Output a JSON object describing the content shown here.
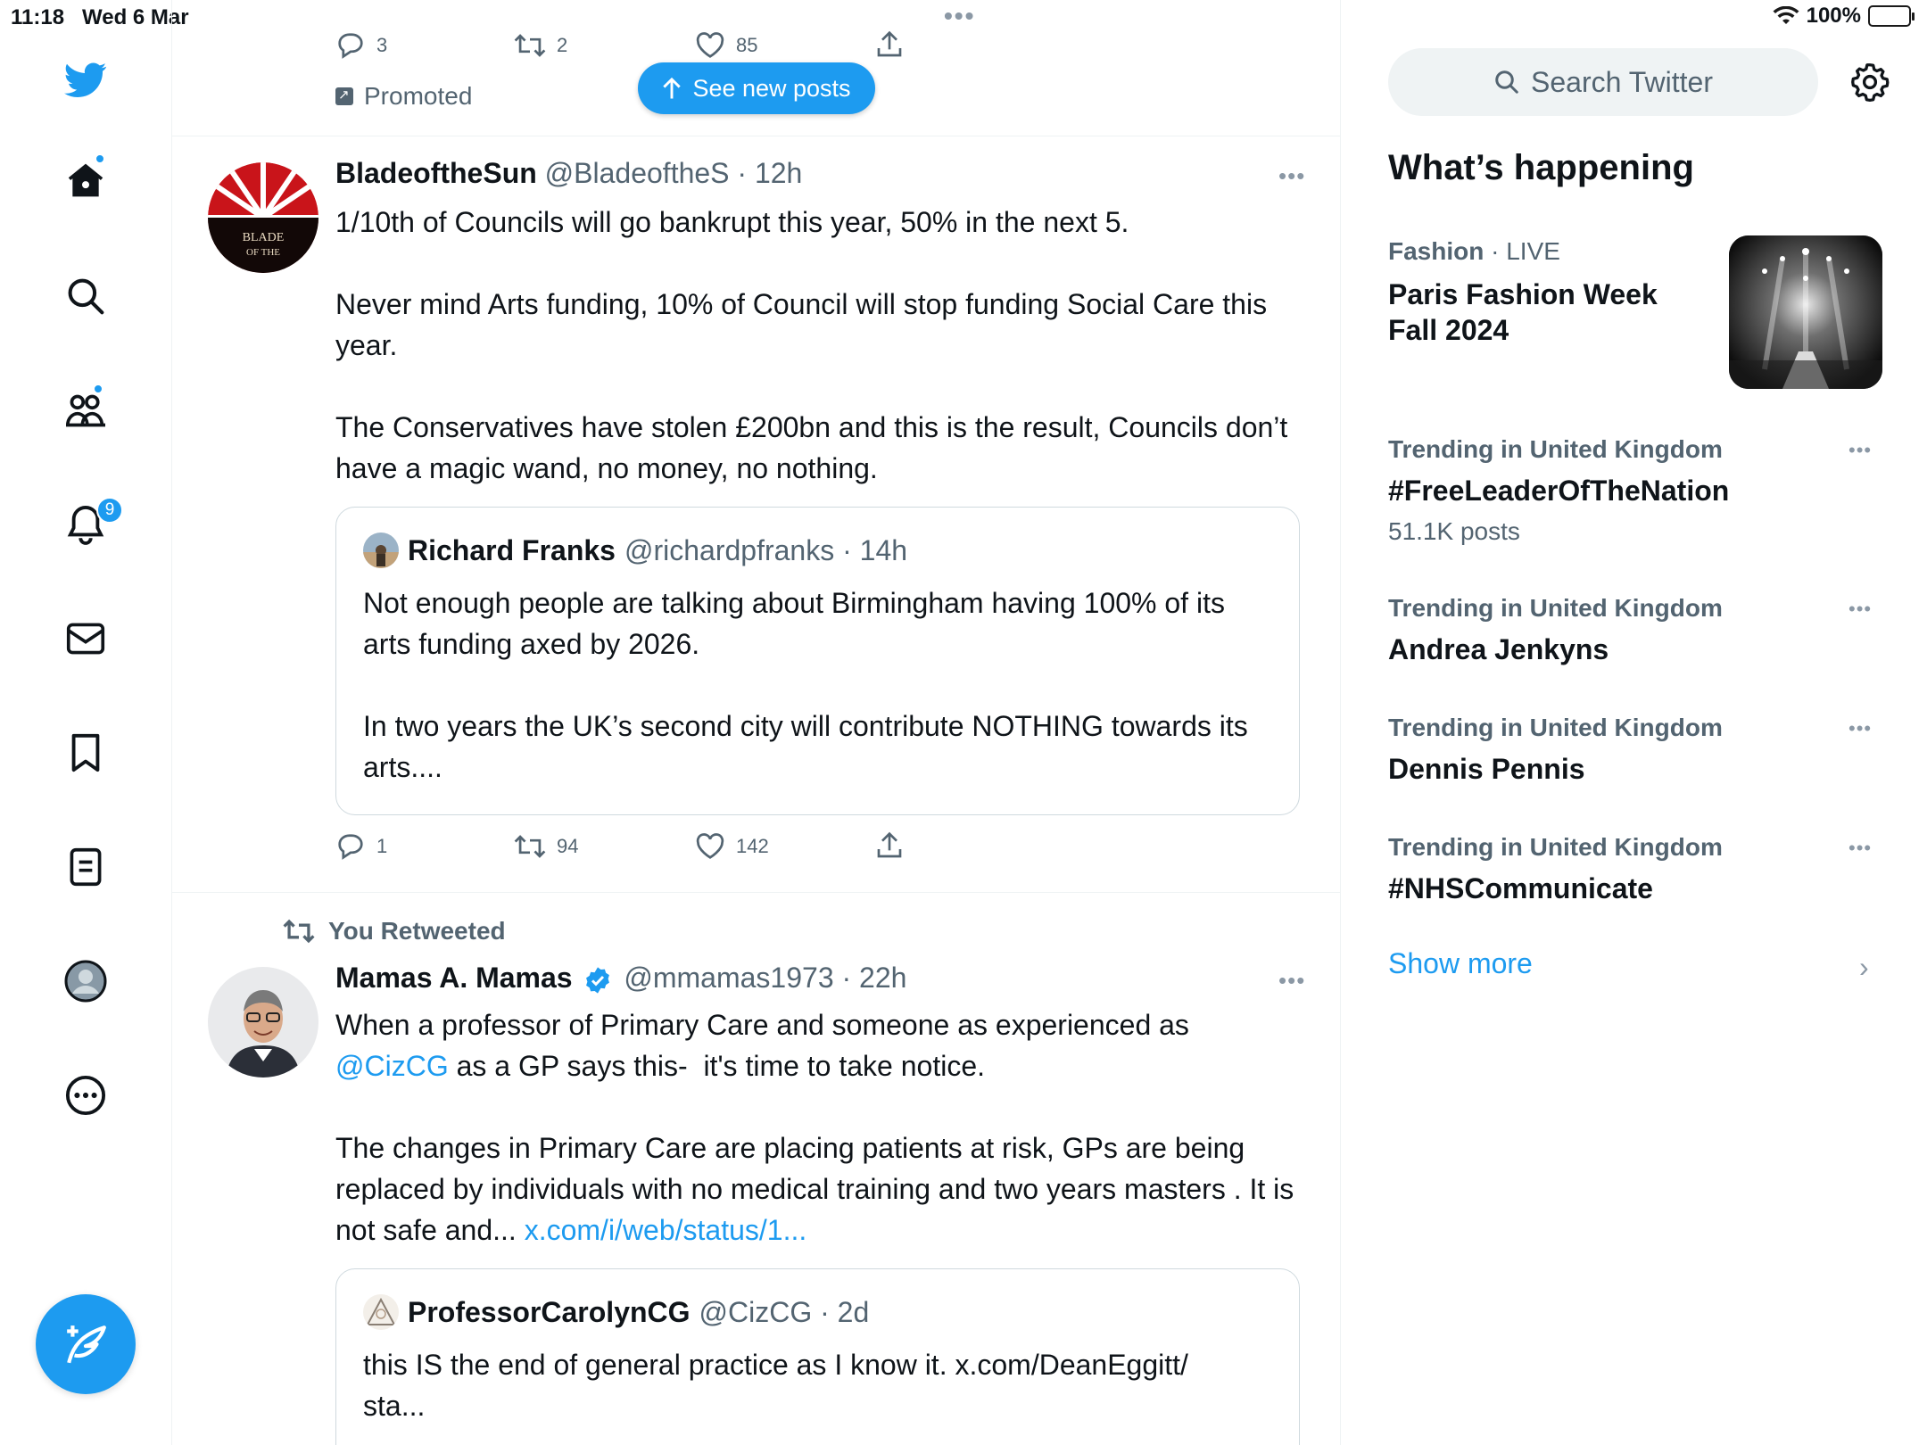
{
  "status_bar": {
    "time": "11:18",
    "date": "Wed 6 Mar",
    "battery": "100%"
  },
  "nav": {
    "notifications_badge": "9"
  },
  "feed": {
    "prev_tweet": {
      "replies": "3",
      "retweets": "2",
      "likes": "85",
      "promoted_label": "Promoted"
    },
    "see_new_posts": "See new posts",
    "tweet1": {
      "name": "BladeoftheSun",
      "meta": "@BladeoftheS · 12h",
      "avatar_text": "BLADE OF THE SUN",
      "body": "1/10th of Councils will go bankrupt this year, 50% in the next 5.\n\nNever mind Arts funding, 10% of Council will stop funding Social Care this year.\n\nThe Conservatives have stolen £200bn and this is the result, Councils don’t have a magic wand, no money, no nothing.",
      "quote": {
        "name": "Richard Franks",
        "meta": "@richardpfranks · 14h",
        "body": "Not enough people are talking about Birmingham having 100% of its arts funding axed by 2026.\n\nIn two years the UK’s second city will contribute NOTHING towards its arts...."
      },
      "replies": "1",
      "retweets": "94",
      "likes": "142"
    },
    "tweet2": {
      "retweet_label": "You Retweeted",
      "name": "Mamas A. Mamas",
      "meta": "@mmamas1973 · 22h",
      "body_line1": "When a professor of Primary Care and someone as experienced as",
      "mention": "@CizCG",
      "body_line2": " as a GP says this-  it's time to take notice.",
      "body_para2": "The changes in Primary Care are placing patients at risk, GPs are being replaced by individuals with no medical training and two years masters . It is not safe and... ",
      "link": "x.com/i/web/status/1...",
      "quote": {
        "name": "ProfessorCarolynCG",
        "meta": "@CizCG · 2d",
        "body": "this IS the end of general practice as I know it. x.com/DeanEggitt/\nsta..."
      }
    }
  },
  "sidebar": {
    "search_placeholder": "Search Twitter",
    "title": "What’s happening",
    "featured": {
      "category": "Fashion",
      "live": " · LIVE",
      "name": "Paris Fashion Week Fall 2024"
    },
    "trends": [
      {
        "category": "Trending in United Kingdom",
        "name": "#FreeLeaderOfTheNation",
        "count": "51.1K posts"
      },
      {
        "category": "Trending in United Kingdom",
        "name": "Andrea Jenkyns"
      },
      {
        "category": "Trending in United Kingdom",
        "name": "Dennis Pennis"
      },
      {
        "category": "Trending in United Kingdom",
        "name": "#NHSCommunicate"
      }
    ],
    "show_more": "Show more"
  },
  "colors": {
    "accent": "#1d9bf0",
    "text": "#0f1419",
    "muted": "#536471",
    "border": "#eff3f4"
  },
  "icons": [
    "twitter-logo-icon",
    "home-icon",
    "search-icon",
    "communities-icon",
    "bell-icon",
    "mail-icon",
    "bookmark-icon",
    "lists-icon",
    "profile-icon",
    "more-icon",
    "compose-icon",
    "reply-icon",
    "retweet-icon",
    "like-icon",
    "share-icon",
    "verified-icon",
    "gear-icon",
    "chevron-right-icon"
  ]
}
